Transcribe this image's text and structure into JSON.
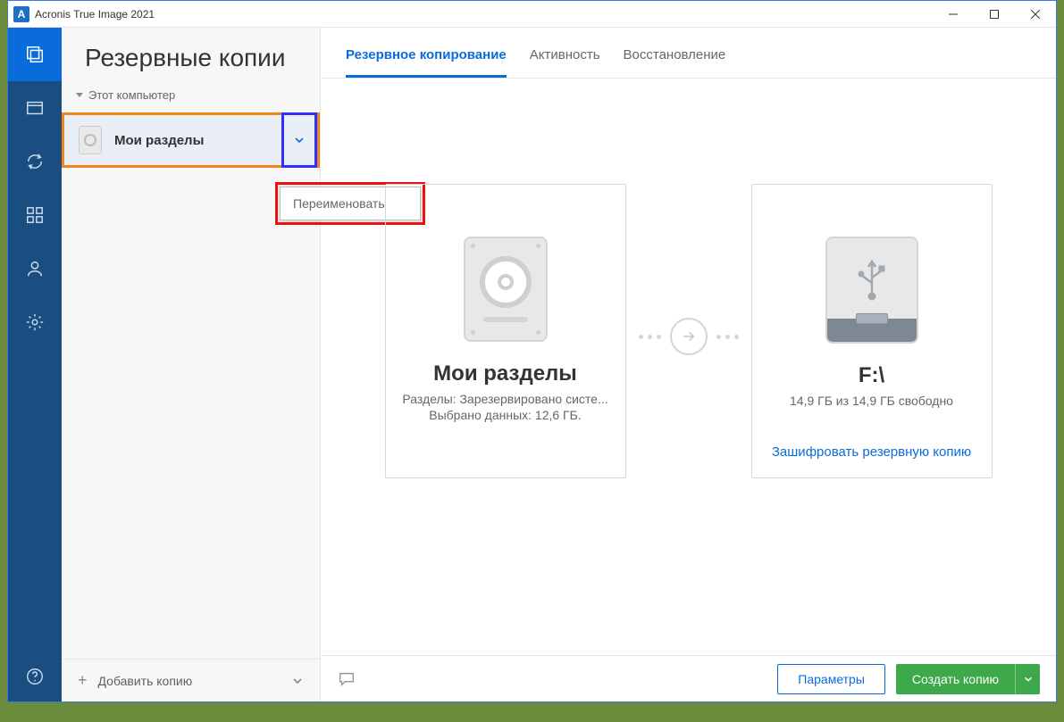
{
  "titlebar": {
    "app_letter": "A",
    "title": "Acronis True Image 2021"
  },
  "nav": {
    "items": [
      {
        "name": "backup",
        "active": true
      },
      {
        "name": "archive",
        "active": false
      },
      {
        "name": "sync",
        "active": false
      },
      {
        "name": "tools",
        "active": false
      },
      {
        "name": "account",
        "active": false
      },
      {
        "name": "settings",
        "active": false
      }
    ],
    "help": "help"
  },
  "sidebar": {
    "header": "Резервные копии",
    "tree_label": "Этот компьютер",
    "backup_name": "Мои разделы",
    "context_menu": {
      "rename": "Переименовать"
    },
    "add_backup": "Добавить копию"
  },
  "tabs": {
    "backup": "Резервное копирование",
    "activity": "Активность",
    "restore": "Восстановление",
    "active": "backup"
  },
  "source": {
    "title": "Мои разделы",
    "line1": "Разделы: Зарезервировано систе...",
    "line2": "Выбрано данных: 12,6 ГБ."
  },
  "destination": {
    "title": "F:\\",
    "line1": "14,9 ГБ из 14,9 ГБ свободно",
    "encrypt_link": "Зашифровать резервную копию"
  },
  "footer": {
    "parameters": "Параметры",
    "create_backup": "Создать копию"
  }
}
